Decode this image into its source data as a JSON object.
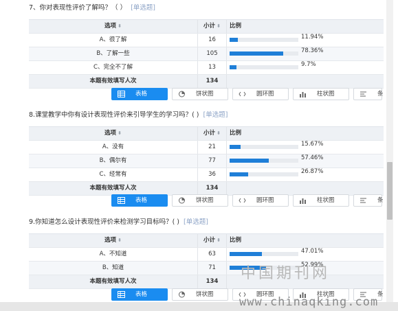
{
  "table_header": {
    "option": "选项",
    "count": "小计",
    "percent": "比例",
    "sort_glyph": "⬍"
  },
  "total_label": "本题有效填写人次",
  "view_buttons": {
    "table": "表格",
    "pie": "饼状图",
    "ring": "圆环图",
    "bar": "柱状图",
    "strip": "条"
  },
  "questions": [
    {
      "title": "7、你对表现性评价了解吗？（ ）",
      "tag": "[单选题]",
      "options": [
        {
          "label": "A、很了解",
          "count": "16",
          "percent": "11.94%",
          "fraction": 0.1194
        },
        {
          "label": "B、了解一些",
          "count": "105",
          "percent": "78.36%",
          "fraction": 0.7836
        },
        {
          "label": "C、完全不了解",
          "count": "13",
          "percent": "9.7%",
          "fraction": 0.097
        }
      ],
      "total": "134"
    },
    {
      "title": "8.课堂教学中你有设计表现性评价来引导学生的学习吗？( )",
      "tag": "[单选题]",
      "options": [
        {
          "label": "A、没有",
          "count": "21",
          "percent": "15.67%",
          "fraction": 0.1567
        },
        {
          "label": "B、偶尔有",
          "count": "77",
          "percent": "57.46%",
          "fraction": 0.5746
        },
        {
          "label": "C、经常有",
          "count": "36",
          "percent": "26.87%",
          "fraction": 0.2687
        }
      ],
      "total": "134"
    },
    {
      "title": "9.你知道怎么设计表现性评价来检测学习目标吗？( )",
      "tag": "[单选题]",
      "options": [
        {
          "label": "A、不知道",
          "count": "63",
          "percent": "47.01%",
          "fraction": 0.4701
        },
        {
          "label": "B、知道",
          "count": "71",
          "percent": "52.99%",
          "fraction": 0.5299
        }
      ],
      "total": "134"
    }
  ],
  "watermark": {
    "cn": "中国期刊网",
    "url": "www.chinaqking.com"
  },
  "colors": {
    "bar": "#1f7fd8",
    "active_button": "#1a8cf0",
    "tag": "#8ea4c7"
  }
}
